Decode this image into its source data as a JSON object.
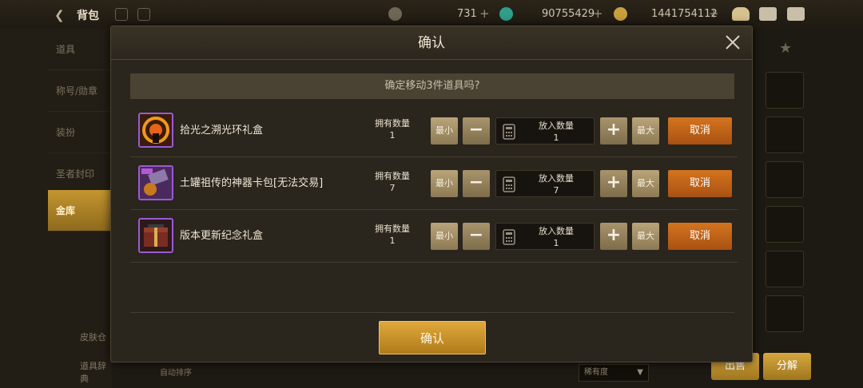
{
  "topbar": {
    "title": "背包",
    "currency_1": "731",
    "currency_2": "90755429",
    "currency_3": "1441754112",
    "plus": "+"
  },
  "sidebar": {
    "items": [
      "道具",
      "称号/勋章",
      "装扮",
      "圣者封印",
      "金库"
    ],
    "bottom": [
      "皮肤仓",
      "道具辞典"
    ]
  },
  "background": {
    "sort_label": "自动排序",
    "rarity_select": "稀有度",
    "btn_1": "出售",
    "btn_2": "分解"
  },
  "modal": {
    "title": "确认",
    "prompt": "确定移动3件道具吗?",
    "confirm_label": "确认",
    "rows": [
      {
        "name": "拾光之溯光环礼盒",
        "own_label": "拥有数量",
        "own_value": "1",
        "min_label": "最小",
        "max_label": "最大",
        "qty_label": "放入数量",
        "qty_value": "1",
        "cancel_label": "取消"
      },
      {
        "name": "土罐祖传的神器卡包[无法交易]",
        "own_label": "拥有数量",
        "own_value": "7",
        "min_label": "最小",
        "max_label": "最大",
        "qty_label": "放入数量",
        "qty_value": "7",
        "cancel_label": "取消"
      },
      {
        "name": "版本更新纪念礼盒",
        "own_label": "拥有数量",
        "own_value": "1",
        "min_label": "最小",
        "max_label": "最大",
        "qty_label": "放入数量",
        "qty_value": "1",
        "cancel_label": "取消"
      }
    ]
  },
  "colors": {
    "accent_gold": "#d49e32",
    "cancel_orange": "#c0651a",
    "item_border": "#9a5ad3"
  }
}
